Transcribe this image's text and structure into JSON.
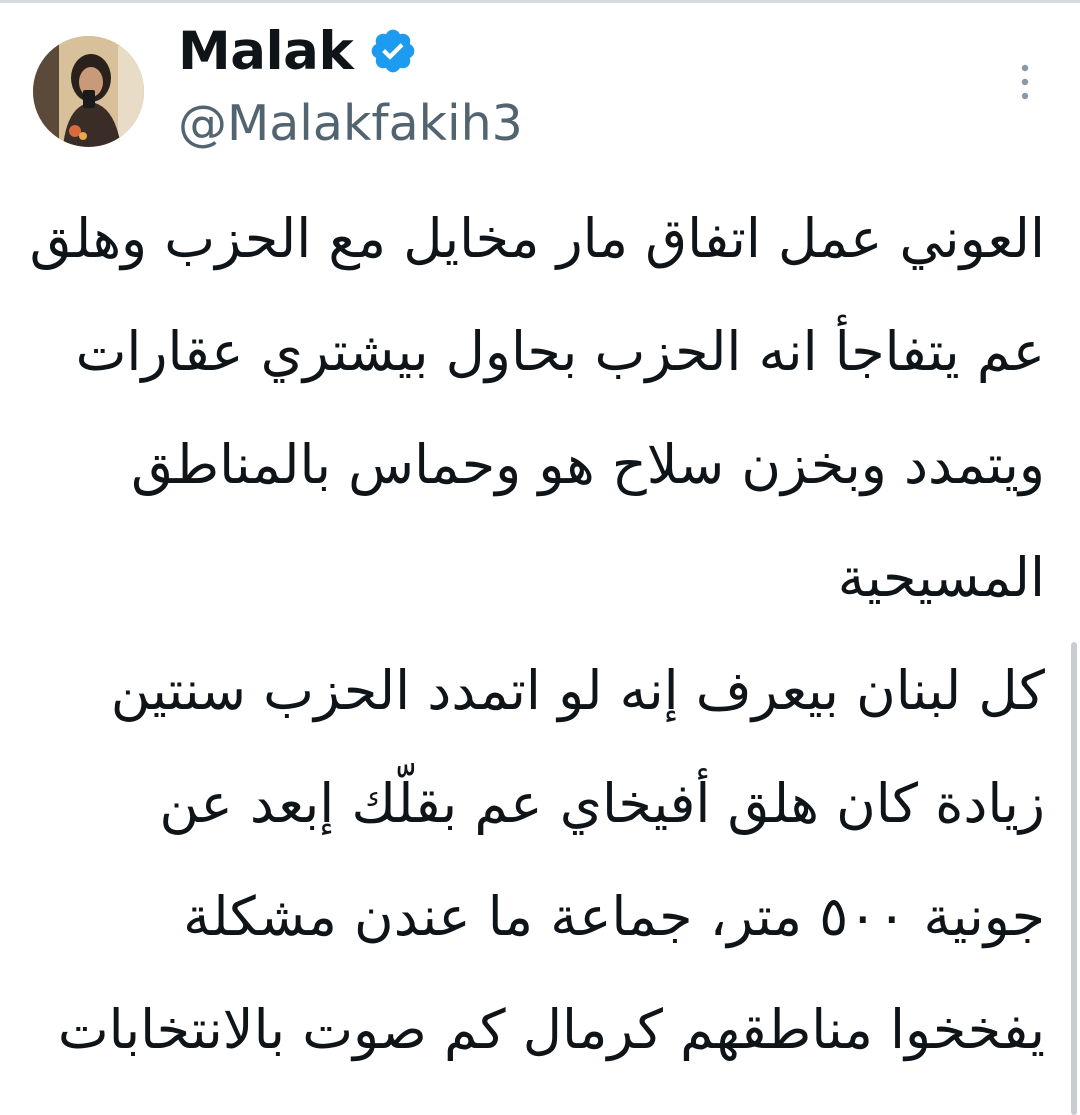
{
  "author": {
    "name": "Malak",
    "handle": "@Malakfakih3",
    "verified_icon": "verified-badge-icon",
    "avatar_icon": "profile-photo-avatar"
  },
  "menu_icon": "more-vertical-icon",
  "colors": {
    "text": "#0f1419",
    "secondary": "#536471",
    "verified": "#1d9bf0"
  },
  "tweet": {
    "lines": [
      "العوني عمل اتفاق مار مخايل مع الحزب وهلق",
      "عم يتفاجأ انه الحزب بحاول بيشتري عقارات",
      "ويتمدد وبخزن سلاح هو وحماس بالمناطق",
      "المسيحية",
      "كل لبنان بيعرف إنه لو اتمدد الحزب سنتين",
      "زيادة كان هلق أفيخاي عم بقلّك إبعد عن",
      "جونية ٥٠٠ متر، جماعة ما عندن مشكلة",
      "يفخخوا مناطقهم كرمال كم صوت بالانتخابات"
    ]
  }
}
